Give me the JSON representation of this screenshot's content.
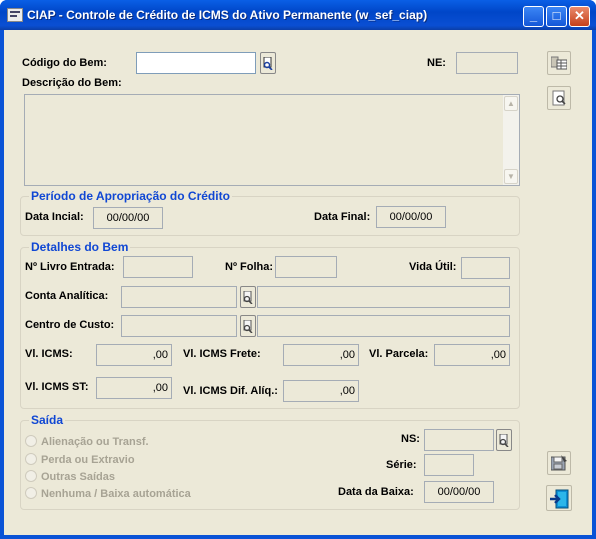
{
  "window": {
    "title": "CIAP - Controle de Crédito de ICMS do Ativo Permanente (w_sef_ciap)",
    "minimize_glyph": "_",
    "maximize_glyph": "□",
    "close_glyph": "✕"
  },
  "header": {
    "codigo_label": "Código do Bem:",
    "codigo_value": "",
    "ne_label": "NE:",
    "ne_value": "",
    "descricao_label": "Descrição do Bem:",
    "descricao_value": ""
  },
  "periodo": {
    "title": "Período de Apropriação do Crédito",
    "data_inicial_label": "Data Incial:",
    "data_inicial_value": "00/00/00",
    "data_final_label": "Data Final:",
    "data_final_value": "00/00/00"
  },
  "detalhes": {
    "title": "Detalhes do Bem",
    "livro_label": "Nº Livro Entrada:",
    "livro_value": "",
    "folha_label": "Nº Folha:",
    "folha_value": "",
    "vida_label": "Vida Útil:",
    "vida_value": "",
    "conta_label": "Conta Analítica:",
    "conta_code": "",
    "conta_desc": "",
    "centro_label": "Centro de Custo:",
    "centro_code": "",
    "centro_desc": "",
    "vl_icms_label": "Vl. ICMS:",
    "vl_icms_value": ",00",
    "vl_frete_label": "Vl. ICMS Frete:",
    "vl_frete_value": ",00",
    "vl_parcela_label": "Vl. Parcela:",
    "vl_parcela_value": ",00",
    "vl_st_label": "Vl. ICMS ST:",
    "vl_st_value": ",00",
    "vl_dif_label": "Vl. ICMS Dif. Alíq.:",
    "vl_dif_value": ",00"
  },
  "saida": {
    "title": "Saída",
    "options": [
      "Alienação ou Transf.",
      "Perda ou Extravio",
      "Outras Saídas",
      "Nenhuma / Baixa automática"
    ],
    "ns_label": "NS:",
    "ns_value": "",
    "serie_label": "Série:",
    "serie_value": "",
    "data_baixa_label": "Data da Baixa:",
    "data_baixa_value": "00/00/00"
  },
  "icons": {
    "lookup": "lookup-icon",
    "grid": "grid-view-icon",
    "preview": "preview-icon",
    "save": "save-icon",
    "exit": "exit-icon"
  },
  "colors": {
    "title_bar": "#0a53d6",
    "group_title": "#1047d4",
    "window_bg": "#ece9d8"
  }
}
